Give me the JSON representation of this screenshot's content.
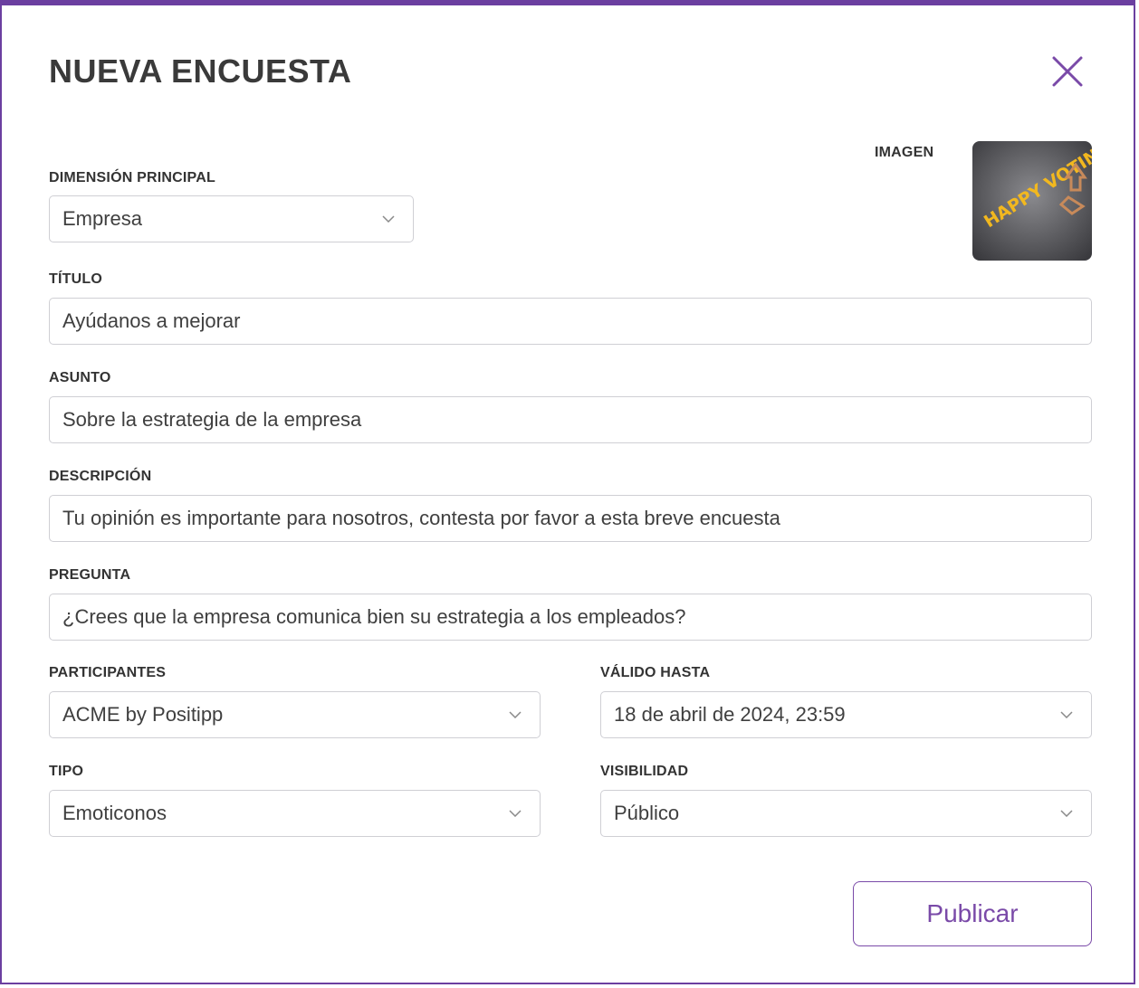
{
  "dialog": {
    "title": "NUEVA ENCUESTA",
    "close_icon": "close-icon"
  },
  "image": {
    "label": "IMAGEN",
    "thumbnail_text": "HAPPY VOTING"
  },
  "dimension": {
    "label": "DIMENSIÓN PRINCIPAL",
    "value": "Empresa"
  },
  "titulo": {
    "label": "TÍTULO",
    "value": "Ayúdanos a mejorar"
  },
  "asunto": {
    "label": "ASUNTO",
    "value": "Sobre la estrategia de la empresa"
  },
  "descripcion": {
    "label": "DESCRIPCIÓN",
    "value": "Tu opinión es importante para nosotros, contesta por favor a esta breve encuesta"
  },
  "pregunta": {
    "label": "PREGUNTA",
    "value": "¿Crees que la empresa comunica bien su estrategia a los empleados?"
  },
  "participantes": {
    "label": "PARTICIPANTES",
    "value": "ACME by Positipp"
  },
  "valido_hasta": {
    "label": "VÁLIDO HASTA",
    "value": "18 de abril de 2024, 23:59"
  },
  "tipo": {
    "label": "TIPO",
    "value": "Emoticonos"
  },
  "visibilidad": {
    "label": "VISIBILIDAD",
    "value": "Público"
  },
  "actions": {
    "publish_label": "Publicar"
  },
  "colors": {
    "accent": "#7a4aa8",
    "border": "#6b3fa0",
    "field_border": "#cfcfd4",
    "text": "#3f3f3f"
  }
}
